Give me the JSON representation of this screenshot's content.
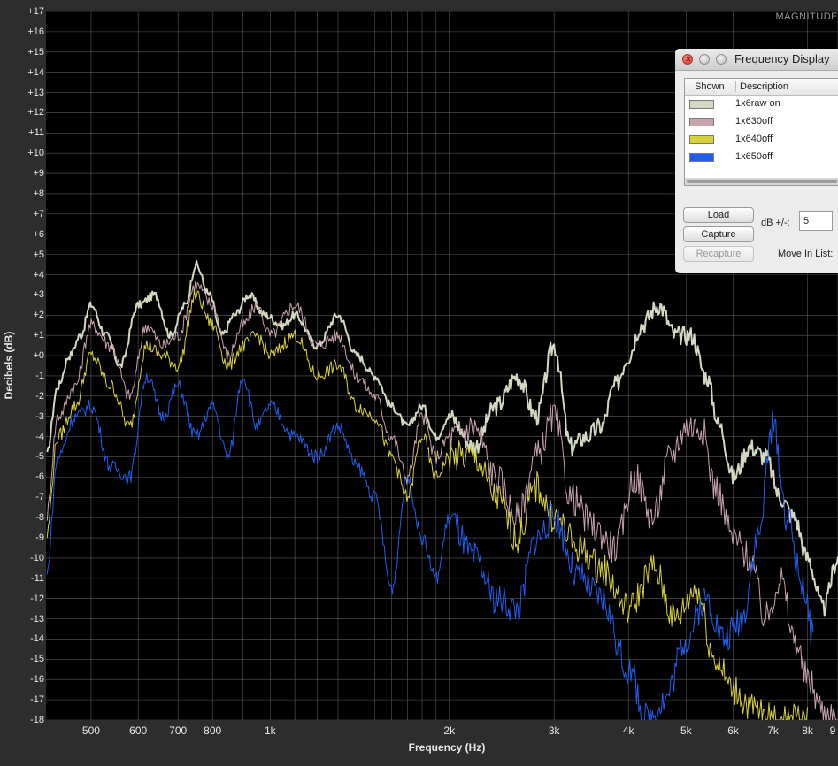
{
  "app": {
    "mode_label": "MAGNITUDE",
    "accent_color": "#000000"
  },
  "chart_data": {
    "type": "line",
    "title": "",
    "xlabel": "Frequency (Hz)",
    "ylabel": "Decibels (dB)",
    "x_scale": "log",
    "xlim": [
      420,
      9000
    ],
    "ylim": [
      -18,
      17
    ],
    "grid": true,
    "x_ticks": [
      "500",
      "600",
      "700",
      "800",
      "1k",
      "2k",
      "3k",
      "4k",
      "5k",
      "6k",
      "7k",
      "8k",
      "9"
    ],
    "x_tick_values": [
      500,
      600,
      700,
      800,
      1000,
      2000,
      3000,
      4000,
      5000,
      6000,
      7000,
      8000,
      9000
    ],
    "y_ticks": [
      "+17",
      "+16",
      "+15",
      "+14",
      "+13",
      "+12",
      "+11",
      "+10",
      "+9",
      "+8",
      "+7",
      "+6",
      "+5",
      "+4",
      "+3",
      "+2",
      "+1",
      "+0",
      "-1",
      "-2",
      "-3",
      "-4",
      "-5",
      "-6",
      "-7",
      "-8",
      "-9",
      "-10",
      "-11",
      "-12",
      "-13",
      "-14",
      "-15",
      "-16",
      "-17",
      "-18"
    ],
    "series": [
      {
        "name": "1x6raw on",
        "color": "#d4d9c2",
        "width": 2,
        "x": [
          420,
          440,
          460,
          480,
          500,
          530,
          560,
          600,
          640,
          680,
          720,
          750,
          790,
          830,
          870,
          920,
          980,
          1050,
          1100,
          1200,
          1300,
          1400,
          1500,
          1600,
          1700,
          1800,
          1900,
          2000,
          2200,
          2400,
          2600,
          2800,
          3000,
          3200,
          3400,
          3600,
          3800,
          4000,
          4200,
          4500,
          4800,
          5100,
          5400,
          5700,
          6000,
          6400,
          6800,
          7200,
          7600,
          8000,
          8500,
          9000
        ],
        "y": [
          -5.0,
          -1.5,
          0.0,
          1.0,
          2.5,
          1.0,
          -0.5,
          2.5,
          3.0,
          1.0,
          2.5,
          4.5,
          3.0,
          1.0,
          2.0,
          3.0,
          2.0,
          1.5,
          2.0,
          0.5,
          2.0,
          0.0,
          -1.0,
          -2.5,
          -3.5,
          -2.5,
          -4.0,
          -3.0,
          -4.5,
          -2.5,
          -1.0,
          -3.0,
          0.5,
          -4.5,
          -4.0,
          -3.5,
          -1.5,
          0.0,
          1.5,
          2.5,
          1.0,
          1.0,
          -1.0,
          -3.5,
          -6.0,
          -4.5,
          -5.0,
          -7.0,
          -8.0,
          -10.0,
          -12.5,
          -10.0
        ]
      },
      {
        "name": "1x630off",
        "color": "#c9a3ac",
        "width": 1,
        "x": [
          420,
          440,
          470,
          500,
          540,
          580,
          620,
          660,
          700,
          750,
          800,
          850,
          900,
          950,
          1000,
          1100,
          1200,
          1300,
          1400,
          1500,
          1600,
          1700,
          1800,
          1900,
          2000,
          2200,
          2400,
          2600,
          2800,
          3000,
          3200,
          3500,
          3800,
          4100,
          4400,
          4700,
          5000,
          5300,
          5600,
          6000,
          6400,
          6800,
          7200,
          7600,
          8000,
          8500,
          9000
        ],
        "y": [
          -8.0,
          -3.0,
          -1.5,
          1.5,
          0.5,
          -2.0,
          1.5,
          0.5,
          1.0,
          3.5,
          2.5,
          0.0,
          1.5,
          2.5,
          1.0,
          2.5,
          0.5,
          1.0,
          -1.0,
          -2.0,
          -4.0,
          -6.0,
          -3.0,
          -5.0,
          -4.0,
          -3.5,
          -6.0,
          -8.0,
          -5.0,
          -3.0,
          -7.0,
          -8.5,
          -9.5,
          -6.0,
          -8.0,
          -5.0,
          -3.5,
          -3.5,
          -6.5,
          -9.0,
          -10.0,
          -13.0,
          -11.0,
          -14.0,
          -16.0,
          -17.5,
          -18.0
        ]
      },
      {
        "name": "1x640off",
        "color": "#d8d23a",
        "width": 1,
        "x": [
          420,
          440,
          470,
          500,
          540,
          580,
          620,
          660,
          700,
          750,
          800,
          850,
          900,
          950,
          1000,
          1100,
          1200,
          1300,
          1400,
          1500,
          1600,
          1700,
          1800,
          1900,
          2000,
          2200,
          2400,
          2600,
          2800,
          3000,
          3300,
          3600,
          4000,
          4400,
          4800,
          5200,
          5600,
          6000,
          6500,
          7000,
          7500,
          8000
        ],
        "y": [
          -9.0,
          -4.0,
          -2.5,
          0.0,
          -1.5,
          -3.5,
          0.5,
          0.0,
          -0.5,
          3.0,
          1.5,
          -0.5,
          0.5,
          1.0,
          0.0,
          1.0,
          -1.0,
          -0.5,
          -2.5,
          -3.0,
          -5.0,
          -7.0,
          -4.0,
          -6.0,
          -5.0,
          -5.0,
          -7.0,
          -9.0,
          -6.5,
          -8.0,
          -9.5,
          -10.5,
          -12.5,
          -10.5,
          -13.0,
          -11.5,
          -15.0,
          -16.5,
          -17.5,
          -18.0,
          -18.0,
          -18.0
        ]
      },
      {
        "name": "1x650off",
        "color": "#1f5ef0",
        "width": 1,
        "x": [
          420,
          440,
          470,
          500,
          540,
          580,
          620,
          660,
          700,
          750,
          800,
          850,
          900,
          950,
          1000,
          1100,
          1200,
          1300,
          1400,
          1500,
          1600,
          1700,
          1800,
          1900,
          2000,
          2200,
          2400,
          2600,
          2800,
          3000,
          3300,
          3600,
          4000,
          4300,
          4600,
          5000,
          5400,
          5800,
          6200,
          6600,
          7000,
          7400,
          7800,
          8200
        ],
        "y": [
          -11.0,
          -5.0,
          -3.0,
          -2.5,
          -5.5,
          -6.0,
          -1.0,
          -3.0,
          -1.5,
          -4.0,
          -2.5,
          -5.0,
          -1.0,
          -3.5,
          -2.5,
          -4.0,
          -5.0,
          -3.5,
          -5.5,
          -7.0,
          -11.5,
          -6.0,
          -9.0,
          -11.0,
          -8.0,
          -10.0,
          -12.0,
          -12.5,
          -9.0,
          -8.0,
          -11.0,
          -12.0,
          -15.5,
          -18.0,
          -17.0,
          -14.0,
          -12.0,
          -14.0,
          -13.0,
          -9.0,
          -3.5,
          -8.0,
          -11.0,
          -14.0
        ]
      }
    ]
  },
  "window": {
    "title": "Frequency Display",
    "columns": {
      "shown": "Shown",
      "description": "Description"
    },
    "items": [
      {
        "label": "1x6raw on",
        "color": "#d4d9c2"
      },
      {
        "label": "1x630off",
        "color": "#c9a3ac"
      },
      {
        "label": "1x640off",
        "color": "#d8d23a"
      },
      {
        "label": "1x650off",
        "color": "#1f5ef0"
      }
    ],
    "load_label": "Load",
    "capture_label": "Capture",
    "recapture_label": "Recapture",
    "db_label": "dB +/-:",
    "db_value": "5",
    "move_label": "Move In List:"
  }
}
